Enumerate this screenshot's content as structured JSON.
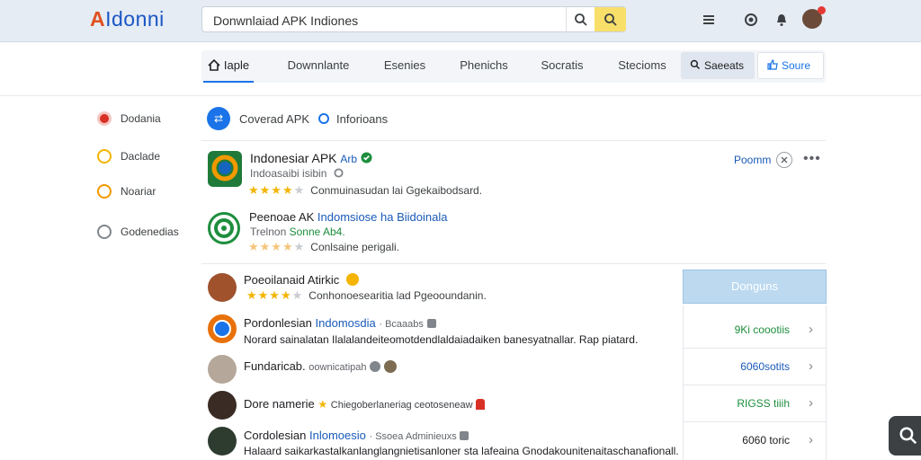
{
  "header": {
    "logo": "Idonni",
    "logo_mark": "A",
    "search_value": "Donwnlaiad APK Indiones"
  },
  "tabs": [
    {
      "label": "Iaple"
    },
    {
      "label": "Downnlante"
    },
    {
      "label": "Esenies"
    },
    {
      "label": "Phenichs"
    },
    {
      "label": "Socratis"
    },
    {
      "label": "Stecioms"
    }
  ],
  "tab_actions": {
    "search_label": "Saeeats",
    "share_label": "Soure"
  },
  "sidebar": [
    {
      "label": "Dodania"
    },
    {
      "label": "Daclade"
    },
    {
      "label": "Noariar"
    },
    {
      "label": "Godenedias"
    }
  ],
  "filter": {
    "button_glyph": "⇄",
    "label": "Coverad APK",
    "label2": "Inforioans"
  },
  "top_card": {
    "title": "Indonesiar APK",
    "badge": "Arb",
    "subtitle": "Indoasaibi isibin",
    "rating": 4,
    "review": "Conmuinasudan lai Ggekaibodsard.",
    "action_label": "Poomm",
    "second_title_a": "Peenoae AK",
    "second_title_b": "Indomsiose ha Biidoinala",
    "second_subtitle_a": "Trelnon",
    "second_subtitle_b": "Sonne Ab4.",
    "second_rating": 4,
    "second_review": "Conlsaine perigali."
  },
  "feed": [
    {
      "title": "Poeoilanaid Atirkic",
      "rating": 4,
      "review": "Conhonoesearitia lad Pgeooundanin."
    },
    {
      "title_a": "Pordonlesian",
      "title_b": "Indomosdia",
      "tag": "· Bcaaabs",
      "body": "Norard sainalatan Ilalalandeiteomotdendlaldaiadaiken banesyatnallar. Rap piatard."
    },
    {
      "title": "Fundaricab.",
      "meta": "oownicatipah"
    },
    {
      "title": "Dore namerie",
      "meta": "Chiegoberlaneriag ceotoseneaw"
    },
    {
      "title_a": "Cordolesian",
      "title_b": "Inlomoesio",
      "tag": "· Ssoea Adminieuxs",
      "body": "Halaard saikarkastalkanlanglangnietisanloner sta lafeaina Gnodakounitenaitaschanafionall."
    }
  ],
  "right_panel": {
    "button": "Donguns",
    "items": [
      {
        "value": "9Ki coootiis",
        "color": "#1e8e3e"
      },
      {
        "value": "6060sotits",
        "color": "#1a5ab8"
      },
      {
        "value": "RIGSS tiiih",
        "color": "#1e8e3e"
      },
      {
        "value": "6060 toric",
        "color": "#202124"
      }
    ]
  },
  "colors": {
    "accent": "#1a73e8",
    "star": "#f4b400",
    "logo_mark": "#e0501f"
  },
  "icons": [
    "search-icon",
    "menu-icon",
    "camera-icon",
    "bell-icon",
    "avatar",
    "share-icon",
    "verified-icon",
    "more-icon",
    "close-icon",
    "chevron-right-icon"
  ]
}
